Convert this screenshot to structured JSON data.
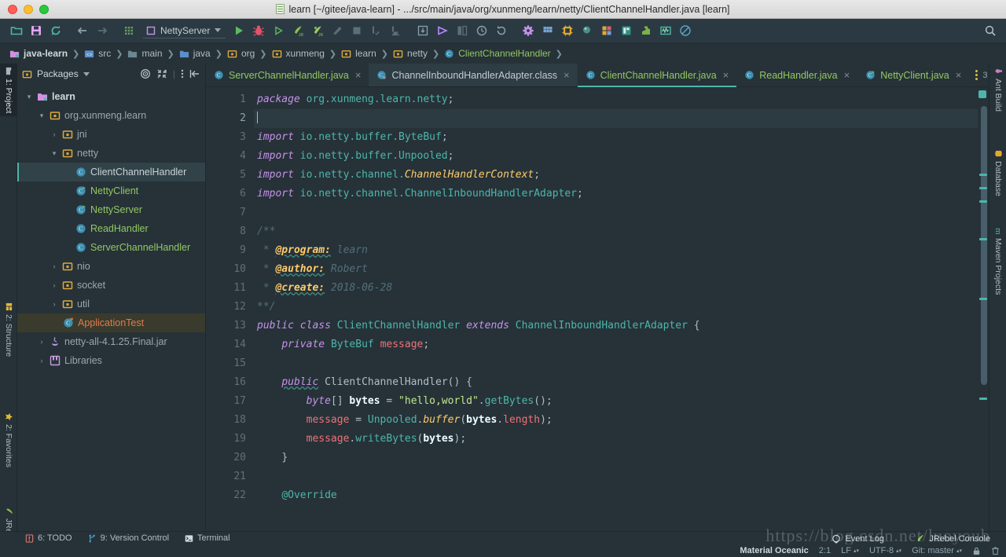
{
  "window": {
    "title": "learn [~/gitee/java-learn] - .../src/main/java/org/xunmeng/learn/netty/ClientChannelHandler.java [learn]",
    "title_icon": "java-file-icon"
  },
  "toolbar": {
    "run_config": "NettyServer",
    "icons": [
      "open-folder-icon",
      "save-all-icon",
      "sync-icon",
      "back-arrow-icon",
      "forward-arrow-icon",
      "grid-menu-icon"
    ],
    "action_icons": [
      "run-icon",
      "debug-icon",
      "run-with-coverage-icon",
      "profile-jr-icon",
      "debug-jr-icon",
      "attach-icon",
      "stop-icon",
      "step-over-icon",
      "step-into-icon",
      "update-app-icon",
      "run-anything-icon",
      "compare-icon",
      "history-icon",
      "revert-icon",
      "settings-gear-icon",
      "project-structure-icon",
      "sdk-icon",
      "search-everywhere-icon",
      "layout-icon",
      "database-icon",
      "plugin-icon",
      "monitor-icon",
      "no-access-icon"
    ],
    "search_icon": "magnifier-icon"
  },
  "breadcrumb": {
    "items": [
      {
        "label": "java-learn",
        "icon": "module-icon"
      },
      {
        "label": "src",
        "icon": "source-root-icon"
      },
      {
        "label": "main",
        "icon": "folder-icon"
      },
      {
        "label": "java",
        "icon": "source-folder-icon"
      },
      {
        "label": "org",
        "icon": "package-icon"
      },
      {
        "label": "xunmeng",
        "icon": "package-icon"
      },
      {
        "label": "learn",
        "icon": "package-icon"
      },
      {
        "label": "netty",
        "icon": "package-icon"
      },
      {
        "label": "ClientChannelHandler",
        "icon": "class-icon"
      }
    ]
  },
  "left_strip": {
    "tabs": [
      {
        "label": "1: Project",
        "icon": "project-icon",
        "selected": true
      },
      {
        "label": "2: Structure",
        "icon": "structure-icon",
        "selected": false
      },
      {
        "label": "2: Favorites",
        "icon": "star-icon",
        "selected": false
      },
      {
        "label": "JRebel",
        "icon": "jrebel-icon",
        "selected": false
      }
    ]
  },
  "right_strip": {
    "tabs": [
      {
        "label": "Ant Build",
        "icon": "ant-icon"
      },
      {
        "label": "Database",
        "icon": "database-icon"
      },
      {
        "label": "Maven Projects",
        "icon": "maven-icon"
      }
    ]
  },
  "project_panel": {
    "header": {
      "title": "Packages",
      "icon": "package-view-icon",
      "dropdown": "▾"
    },
    "header_actions": [
      "locate-target-icon",
      "collapse-all-icon",
      "more-options-icon",
      "hide-panel-icon"
    ],
    "tree": [
      {
        "label": "learn",
        "depth": 0,
        "arrow": "▾",
        "icon": "module-icon",
        "state": "normal"
      },
      {
        "label": "org.xunmeng.learn",
        "depth": 1,
        "arrow": "▾",
        "icon": "package-icon",
        "state": "normal"
      },
      {
        "label": "jni",
        "depth": 2,
        "arrow": "›",
        "icon": "package-icon",
        "state": "normal"
      },
      {
        "label": "netty",
        "depth": 2,
        "arrow": "▾",
        "icon": "package-icon",
        "state": "normal"
      },
      {
        "label": "ClientChannelHandler",
        "depth": 3,
        "arrow": "",
        "icon": "class-icon",
        "state": "selected"
      },
      {
        "label": "NettyClient",
        "depth": 3,
        "arrow": "",
        "icon": "runnable-class-icon",
        "state": "green"
      },
      {
        "label": "NettyServer",
        "depth": 3,
        "arrow": "",
        "icon": "runnable-class-icon",
        "state": "green"
      },
      {
        "label": "ReadHandler",
        "depth": 3,
        "arrow": "",
        "icon": "class-icon",
        "state": "green"
      },
      {
        "label": "ServerChannelHandler",
        "depth": 3,
        "arrow": "",
        "icon": "class-icon",
        "state": "green"
      },
      {
        "label": "nio",
        "depth": 2,
        "arrow": "›",
        "icon": "package-icon",
        "state": "normal"
      },
      {
        "label": "socket",
        "depth": 2,
        "arrow": "›",
        "icon": "package-icon",
        "state": "normal"
      },
      {
        "label": "util",
        "depth": 2,
        "arrow": "›",
        "icon": "package-icon",
        "state": "normal"
      },
      {
        "label": "ApplicationTest",
        "depth": 2,
        "arrow": "",
        "icon": "test-class-icon",
        "state": "test"
      },
      {
        "label": "netty-all-4.1.25.Final.jar",
        "depth": 1,
        "arrow": "›",
        "icon": "jar-icon",
        "state": "normal"
      },
      {
        "label": "Libraries",
        "depth": 1,
        "arrow": "›",
        "icon": "library-icon",
        "state": "normal"
      }
    ]
  },
  "editor_tabs": {
    "items": [
      {
        "label": "ServerChannelHandler.java",
        "icon": "class-icon",
        "active": false,
        "pinned": false
      },
      {
        "label": "ChannelInboundHandlerAdapter.class",
        "icon": "class-locked-icon",
        "active": false,
        "selected_bg": true
      },
      {
        "label": "ClientChannelHandler.java",
        "icon": "class-icon",
        "active": true
      },
      {
        "label": "ReadHandler.java",
        "icon": "class-icon",
        "active": false
      },
      {
        "label": "NettyClient.java",
        "icon": "runnable-class-icon",
        "active": false
      }
    ],
    "overflow_count": "3",
    "overflow_icon": "more-tabs-icon"
  },
  "code": {
    "lines": [
      {
        "n": "1",
        "fold": "",
        "cur": false
      },
      {
        "n": "2",
        "fold": "",
        "cur": true
      },
      {
        "n": "3",
        "fold": "⊟",
        "cur": false
      },
      {
        "n": "4",
        "fold": "",
        "cur": false
      },
      {
        "n": "5",
        "fold": "",
        "cur": false
      },
      {
        "n": "6",
        "fold": "⌂",
        "cur": false
      },
      {
        "n": "7",
        "fold": "",
        "cur": false
      },
      {
        "n": "8",
        "fold": "⊟",
        "cur": false
      },
      {
        "n": "9",
        "fold": "",
        "cur": false
      },
      {
        "n": "10",
        "fold": "",
        "cur": false
      },
      {
        "n": "11",
        "fold": "",
        "cur": false
      },
      {
        "n": "12",
        "fold": "⌂",
        "cur": false
      },
      {
        "n": "13",
        "fold": "",
        "cur": false
      },
      {
        "n": "14",
        "fold": "",
        "cur": false
      },
      {
        "n": "15",
        "fold": "",
        "cur": false
      },
      {
        "n": "16",
        "fold": "⊟",
        "cur": false
      },
      {
        "n": "17",
        "fold": "",
        "cur": false
      },
      {
        "n": "18",
        "fold": "",
        "cur": false
      },
      {
        "n": "19",
        "fold": "",
        "cur": false
      },
      {
        "n": "20",
        "fold": "⌂",
        "cur": false
      },
      {
        "n": "21",
        "fold": "",
        "cur": false
      },
      {
        "n": "22",
        "fold": "",
        "cur": false
      }
    ],
    "text": [
      "package org.xunmeng.learn.netty;",
      "",
      "import io.netty.buffer.ByteBuf;",
      "import io.netty.buffer.Unpooled;",
      "import io.netty.channel.ChannelHandlerContext;",
      "import io.netty.channel.ChannelInboundHandlerAdapter;",
      "",
      "/**",
      " * @program: learn",
      " * @author: Robert",
      " * @create: 2018-06-28",
      " **/",
      "public class ClientChannelHandler extends ChannelInboundHandlerAdapter {",
      "    private ByteBuf message;",
      "",
      "    public ClientChannelHandler() {",
      "        byte[] bytes = \"hello,world\".getBytes();",
      "        message = Unpooled.buffer(bytes.length);",
      "        message.writeBytes(bytes);",
      "    }",
      "",
      "    @Override"
    ]
  },
  "tool_windows": {
    "items": [
      {
        "label": "6: TODO",
        "shortcut": "6",
        "icon": "todo-icon"
      },
      {
        "label": "9: Version Control",
        "shortcut": "9",
        "icon": "vcs-branch-icon"
      },
      {
        "label": "Terminal",
        "shortcut": "",
        "icon": "terminal-icon"
      }
    ]
  },
  "status_bar": {
    "event_log": "Event Log",
    "event_log_icon": "event-log-icon",
    "jrebel_console": "JRebel Console",
    "jrebel_icon": "jrebel-icon",
    "theme": "Material Oceanic",
    "caret_position": "2:1",
    "line_separator": "LF",
    "encoding": "UTF-8",
    "branch": "Git: master",
    "lock_icon": "read-only-lock-icon",
    "trash_icon": "trash-icon",
    "watermark": "https://blog.csdn.net/luoyoub"
  },
  "colors": {
    "bg": "#263238",
    "panel": "#2b3a42",
    "accent": "#4db6ac",
    "selection": "#314249",
    "keyword": "#c792ea",
    "string": "#c3e88d",
    "field": "#f07178",
    "type": "#4db6ac",
    "comment": "#546e7a",
    "annotation": "#ffcb6b"
  }
}
